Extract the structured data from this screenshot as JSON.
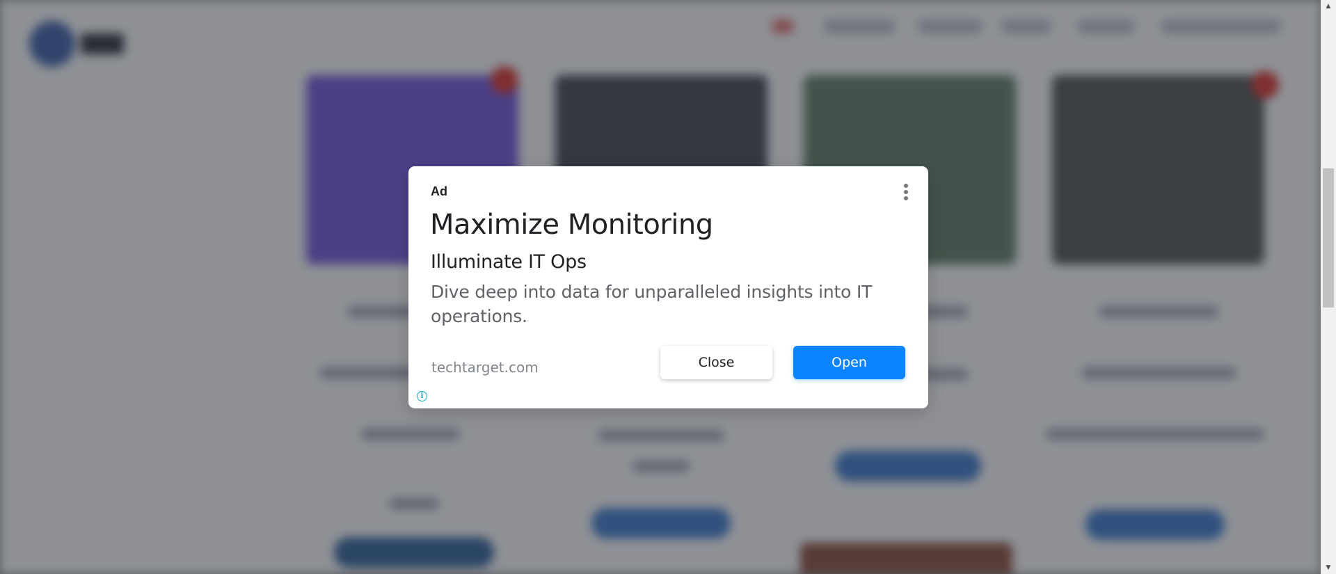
{
  "ad": {
    "label": "Ad",
    "title": "Maximize Monitoring",
    "subtitle": "Illuminate IT Ops",
    "body": "Dive deep into data for unparalleled insights into IT operations.",
    "domain": "techtarget.com",
    "close_label": "Close",
    "open_label": "Open",
    "menu_icon": "more-vert-icon",
    "info_icon": "info-icon",
    "info_glyph": "i"
  },
  "scrollbar": {
    "up_arrow": "▲",
    "down_arrow": "▼"
  },
  "colors": {
    "open_button": "#0a84ff",
    "info_icon": "#00aecd",
    "overlay": "rgba(40, 44, 52, 0.50)"
  }
}
